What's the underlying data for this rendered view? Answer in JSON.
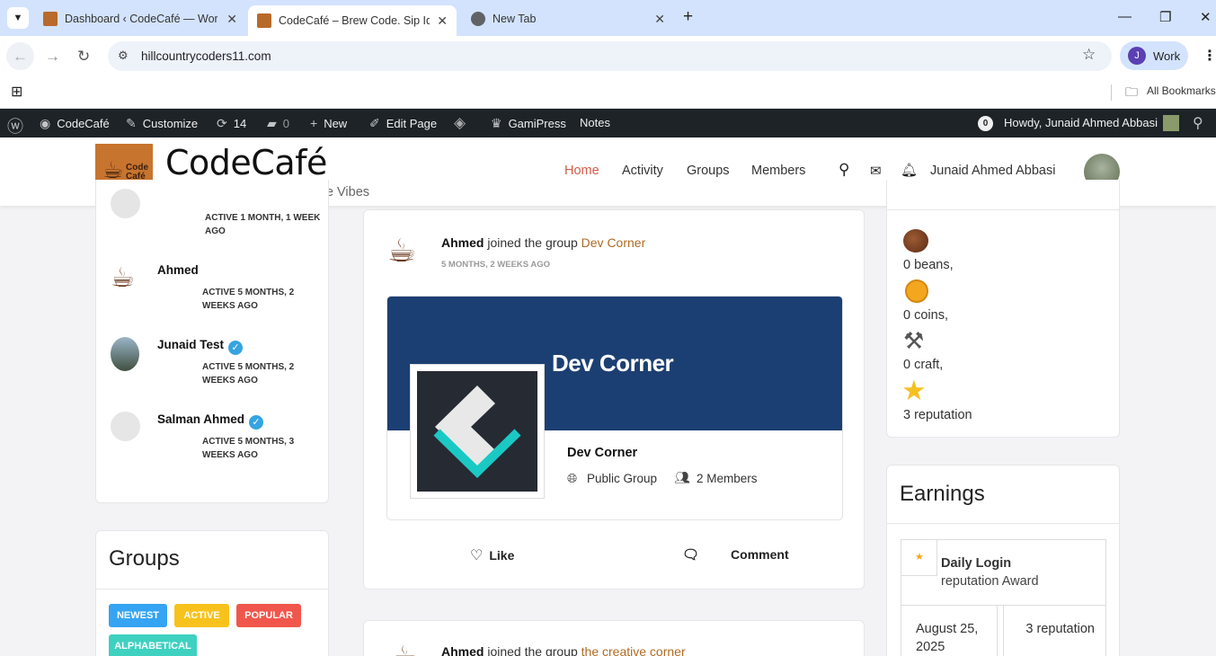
{
  "browser": {
    "tabs": [
      {
        "title": "Dashboard ‹ CodeCafé — WordPress"
      },
      {
        "title": "CodeCafé – Brew Code. Sip Ideas"
      },
      {
        "title": "New Tab"
      }
    ],
    "url": "hillcountrycoders11.com",
    "profile": "Work",
    "profile_initial": "J",
    "bookmarks_label": "All Bookmarks"
  },
  "adminbar": {
    "site": "CodeCafé",
    "customize": "Customize",
    "updates": "14",
    "comments": "0",
    "new": "New",
    "edit": "Edit Page",
    "gamipress": "GamiPress",
    "notes": "Notes",
    "notif_count": "0",
    "howdy": "Howdy, Junaid Ahmed Abbasi"
  },
  "site": {
    "title": "CodeCafé",
    "tagline": "Brew Code. Sip Ideas. Share Vibes",
    "logo_text": "Code Café",
    "menu": [
      "Home",
      "Activity",
      "Groups",
      "Members"
    ],
    "user": "Junaid Ahmed Abbasi"
  },
  "members": [
    {
      "name": "",
      "active": "ACTIVE 1 MONTH, 1 WEEK AGO"
    },
    {
      "name": "Ahmed",
      "active": "ACTIVE 5 MONTHS, 2 WEEKS AGO"
    },
    {
      "name": "Junaid Test",
      "active": "ACTIVE 5 MONTHS, 2 WEEKS AGO"
    },
    {
      "name": "Salman Ahmed",
      "active": "ACTIVE 5 MONTHS, 3 WEEKS AGO"
    }
  ],
  "groups_widget": {
    "title": "Groups",
    "filters": [
      "NEWEST",
      "ACTIVE",
      "POPULAR",
      "ALPHABETICAL"
    ]
  },
  "activity": {
    "user": "Ahmed",
    "action": "joined the group",
    "group": "Dev Corner",
    "time": "5 MONTHS, 2 WEEKS AGO",
    "cover_title": "Dev Corner",
    "group_name": "Dev Corner",
    "privacy": "Public Group",
    "members": "2 Members",
    "like": "Like",
    "comment": "Comment",
    "next_user": "Ahmed",
    "next_action": "joined the group",
    "next_group": "the creative corner"
  },
  "points": [
    {
      "label": "0 beans,"
    },
    {
      "label": "0 coins,"
    },
    {
      "label": "0 craft,"
    },
    {
      "label": "3 reputation"
    }
  ],
  "earnings": {
    "title": "Earnings",
    "award_title": "Daily Login",
    "award_sub": "reputation Award",
    "date": "August 25, 2025",
    "amount": "3 reputation"
  }
}
